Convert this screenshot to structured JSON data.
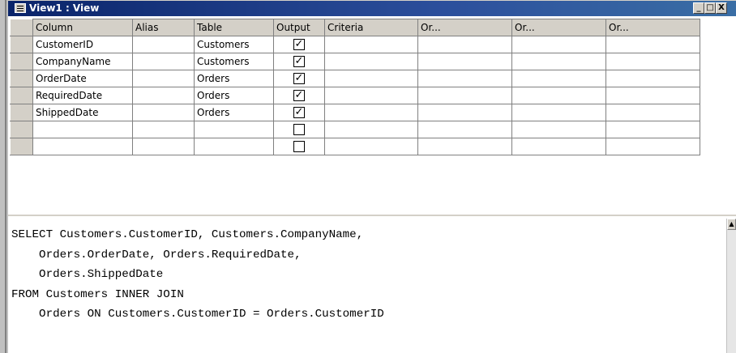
{
  "window": {
    "title": "View1 : View",
    "minimize_label": "_",
    "restore_label": "□",
    "close_label": "X"
  },
  "grid": {
    "headers": [
      "Column",
      "Alias",
      "Table",
      "Output",
      "Criteria",
      "Or...",
      "Or...",
      "Or..."
    ],
    "rows": [
      {
        "column": "CustomerID",
        "alias": "",
        "table": "Customers",
        "output": true,
        "criteria": "",
        "or1": "",
        "or2": "",
        "or3": ""
      },
      {
        "column": "CompanyName",
        "alias": "",
        "table": "Customers",
        "output": true,
        "criteria": "",
        "or1": "",
        "or2": "",
        "or3": ""
      },
      {
        "column": "OrderDate",
        "alias": "",
        "table": "Orders",
        "output": true,
        "criteria": "",
        "or1": "",
        "or2": "",
        "or3": ""
      },
      {
        "column": "RequiredDate",
        "alias": "",
        "table": "Orders",
        "output": true,
        "criteria": "",
        "or1": "",
        "or2": "",
        "or3": ""
      },
      {
        "column": "ShippedDate",
        "alias": "",
        "table": "Orders",
        "output": true,
        "criteria": "",
        "or1": "",
        "or2": "",
        "or3": ""
      },
      {
        "column": "",
        "alias": "",
        "table": "",
        "output": false,
        "criteria": "",
        "or1": "",
        "or2": "",
        "or3": ""
      },
      {
        "column": "",
        "alias": "",
        "table": "",
        "output": false,
        "criteria": "",
        "or1": "",
        "or2": "",
        "or3": ""
      }
    ]
  },
  "sql": {
    "text": "SELECT Customers.CustomerID, Customers.CompanyName,\n    Orders.OrderDate, Orders.RequiredDate,\n    Orders.ShippedDate\nFROM Customers INNER JOIN\n    Orders ON Customers.CustomerID = Orders.CustomerID"
  },
  "colors": {
    "titlebar": "#0a246a",
    "chrome": "#d4d0c8",
    "grid_lines": "#808080"
  }
}
